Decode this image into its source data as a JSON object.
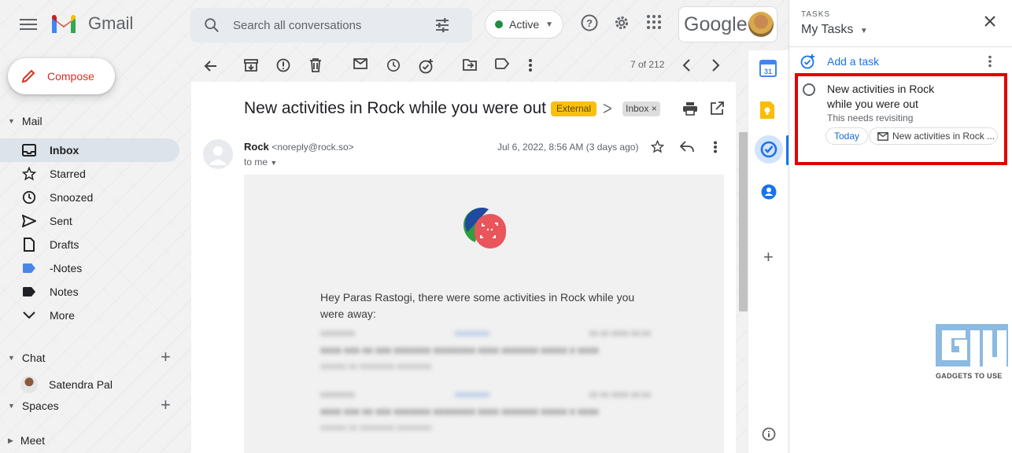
{
  "app": {
    "name": "Gmail"
  },
  "search": {
    "placeholder": "Search all conversations"
  },
  "status": {
    "label": "Active"
  },
  "account": {
    "brand_text": "Google"
  },
  "sidebar": {
    "compose_label": "Compose",
    "mail_section": "Mail",
    "items": [
      {
        "label": "Inbox",
        "icon": "inbox-icon",
        "active": true
      },
      {
        "label": "Starred",
        "icon": "star-icon"
      },
      {
        "label": "Snoozed",
        "icon": "clock-icon"
      },
      {
        "label": "Sent",
        "icon": "send-icon"
      },
      {
        "label": "Drafts",
        "icon": "draft-icon"
      },
      {
        "label": "-Notes",
        "icon": "label-icon",
        "color": "#4a86e8"
      },
      {
        "label": "Notes",
        "icon": "label-icon",
        "color": "#202124"
      },
      {
        "label": "More",
        "icon": "chevron-down-icon"
      }
    ],
    "chat_section": "Chat",
    "chat_user": "Satendra Pal",
    "spaces_section": "Spaces",
    "meet_section": "Meet"
  },
  "toolbar": {
    "pager": "7 of 212"
  },
  "message": {
    "subject": "New activities in Rock while you were out",
    "label_external": "External",
    "label_inbox": "Inbox",
    "sender_name": "Rock",
    "sender_email": "<noreply@rock.so>",
    "to": "to me",
    "date": "Jul 6, 2022, 8:56 AM (3 days ago)",
    "greeting": "Hey Paras Rastogi, there were some activities in Rock while you were away:"
  },
  "tasks_panel": {
    "caption": "TASKS",
    "list_name": "My Tasks",
    "add_label": "Add a task",
    "task": {
      "title_line1": "New activities in Rock",
      "title_line2": "while you were out",
      "notes": "This needs revisiting",
      "due": "Today",
      "source": "New activities in Rock ..."
    }
  },
  "colors": {
    "accent_blue": "#1a73e8",
    "compose_red": "#d93025",
    "external_chip": "#f9c00f",
    "highlight_box": "#e00000",
    "active_green": "#1e8e3e"
  }
}
